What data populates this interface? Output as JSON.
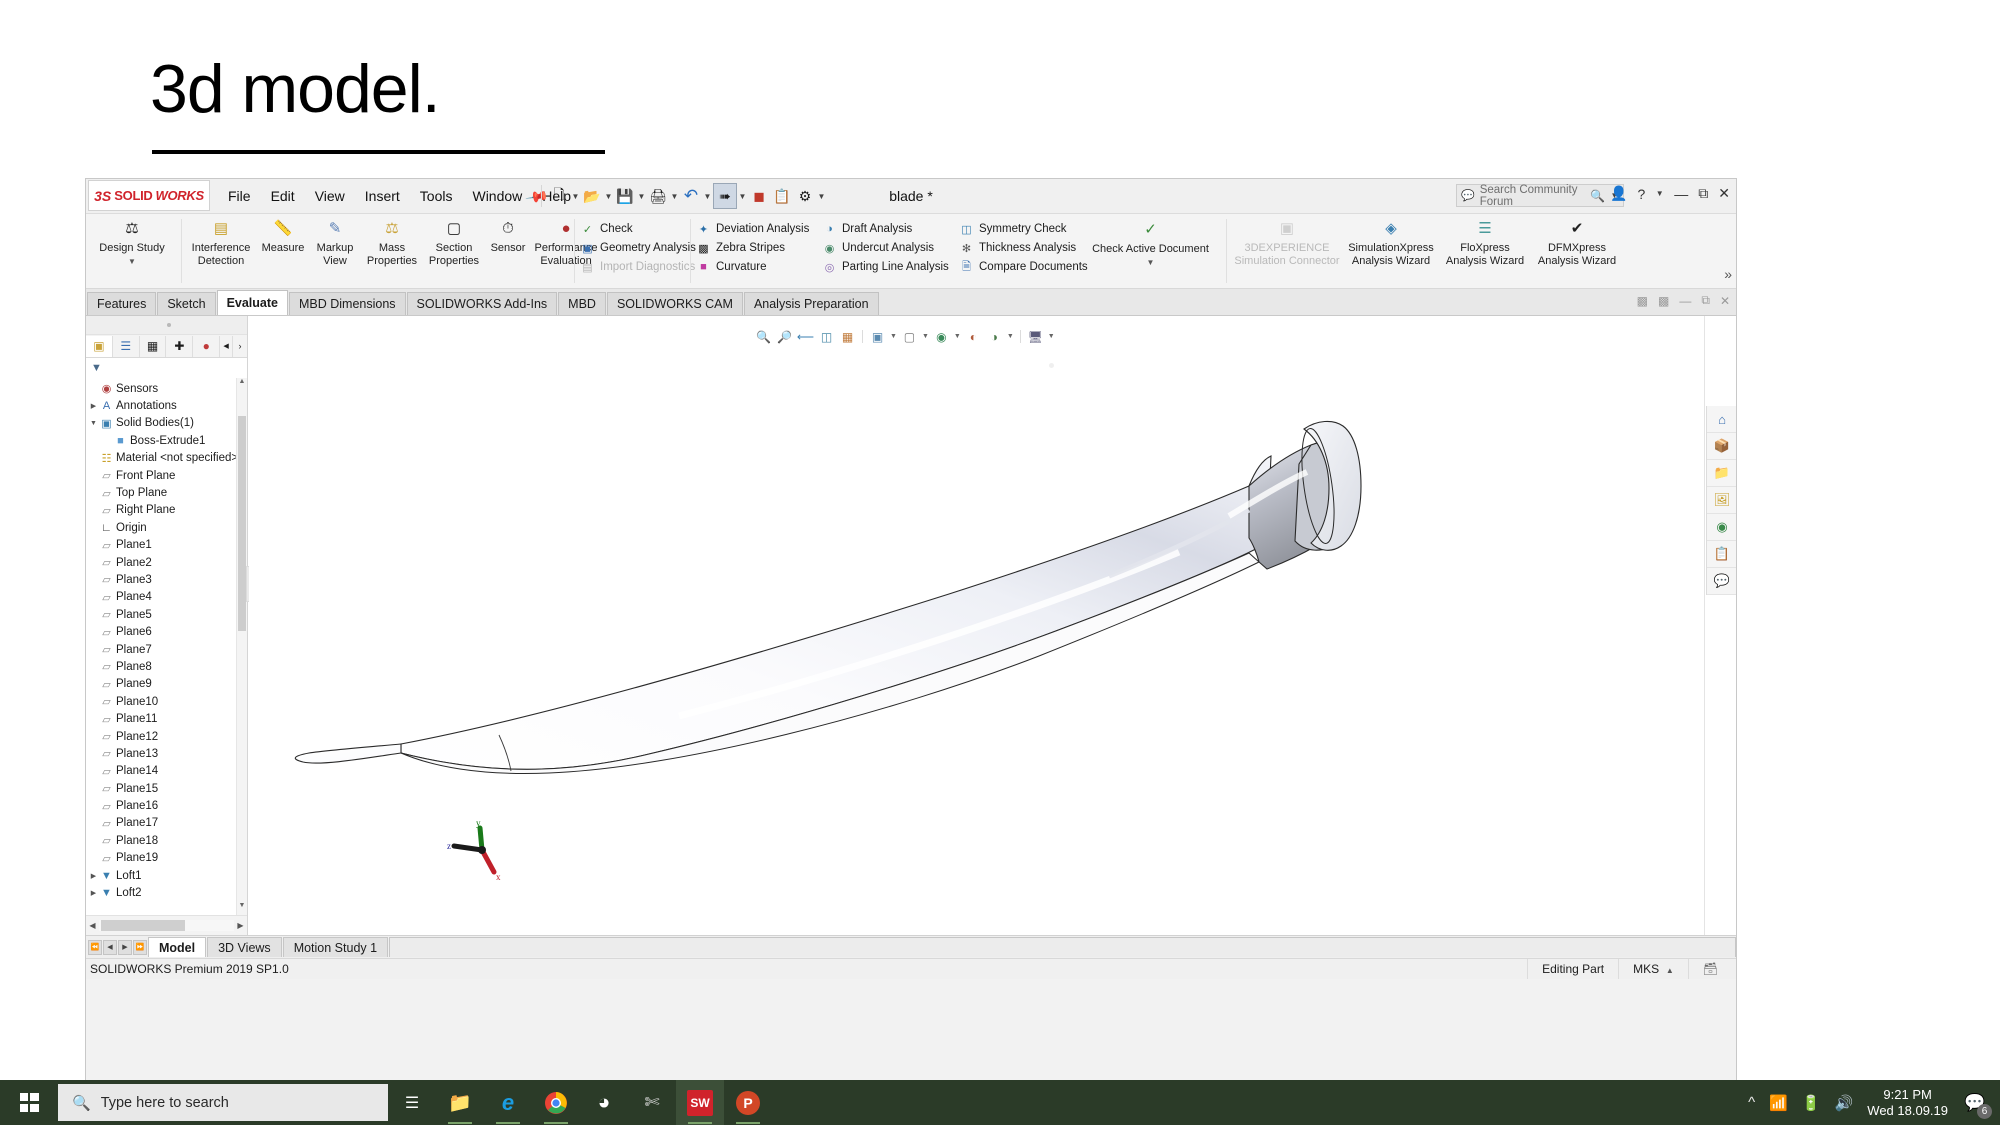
{
  "slide": {
    "title": "3d model."
  },
  "app": {
    "logo": {
      "ds": "3S",
      "solid": "SOLID",
      "works": "WORKS"
    },
    "menu": [
      "File",
      "Edit",
      "View",
      "Insert",
      "Tools",
      "Window",
      "Help"
    ],
    "pin_icon": "pushpin-icon",
    "quick_tools": [
      {
        "name": "new-document",
        "glyph": "🗋",
        "caret": true
      },
      {
        "name": "open-document",
        "glyph": "📂",
        "caret": true
      },
      {
        "name": "save-document",
        "glyph": "💾",
        "caret": true
      },
      {
        "name": "print-document",
        "glyph": "🖨",
        "caret": true
      },
      {
        "name": "undo",
        "glyph": "↶",
        "caret": true
      },
      {
        "name": "select",
        "glyph": "➤",
        "caret": true
      },
      {
        "name": "rebuild",
        "glyph": "🚦",
        "caret": false
      },
      {
        "name": "file-properties",
        "glyph": "📋",
        "caret": false
      },
      {
        "name": "options",
        "glyph": "⚙",
        "caret": true
      }
    ],
    "document_title": "blade *",
    "search": {
      "placeholder": "Search Community Forum",
      "icon": "comment-search-icon"
    },
    "window_controls": [
      "user-icon",
      "help-icon",
      "help-caret",
      "minimize",
      "restore",
      "close"
    ],
    "ribbon": {
      "design_study": {
        "label_line1": "Design Study",
        "label_line2": "",
        "icon": "design-study-icon"
      },
      "big_buttons": [
        {
          "line1": "Interference",
          "line2": "Detection",
          "icon": "interference-detection-icon"
        },
        {
          "line1": "Measure",
          "line2": "",
          "icon": "measure-icon"
        },
        {
          "line1": "Markup",
          "line2": "View",
          "icon": "markup-view-icon"
        },
        {
          "line1": "Mass",
          "line2": "Properties",
          "icon": "mass-properties-icon"
        },
        {
          "line1": "Section",
          "line2": "Properties",
          "icon": "section-properties-icon"
        },
        {
          "line1": "Sensor",
          "line2": "",
          "icon": "sensor-icon"
        },
        {
          "line1": "Performance",
          "line2": "Evaluation",
          "icon": "performance-evaluation-icon"
        }
      ],
      "column_a": [
        {
          "label": "Check",
          "icon": "check-icon",
          "disabled": false
        },
        {
          "label": "Geometry Analysis",
          "icon": "geometry-analysis-icon",
          "disabled": false
        },
        {
          "label": "Import Diagnostics",
          "icon": "import-diagnostics-icon",
          "disabled": true
        }
      ],
      "column_b": [
        {
          "label": "Deviation Analysis",
          "icon": "deviation-analysis-icon",
          "disabled": false
        },
        {
          "label": "Zebra Stripes",
          "icon": "zebra-stripes-icon",
          "disabled": false
        },
        {
          "label": "Curvature",
          "icon": "curvature-icon",
          "disabled": false
        }
      ],
      "column_c": [
        {
          "label": "Draft Analysis",
          "icon": "draft-analysis-icon",
          "disabled": false
        },
        {
          "label": "Undercut Analysis",
          "icon": "undercut-analysis-icon",
          "disabled": false
        },
        {
          "label": "Parting Line Analysis",
          "icon": "parting-line-analysis-icon",
          "disabled": false
        }
      ],
      "column_d": [
        {
          "label": "Symmetry Check",
          "icon": "symmetry-check-icon",
          "disabled": false
        },
        {
          "label": "Thickness Analysis",
          "icon": "thickness-analysis-icon",
          "disabled": false
        },
        {
          "label": "Compare Documents",
          "icon": "compare-documents-icon",
          "disabled": false
        }
      ],
      "check_active": {
        "line1": "Check Active Document",
        "icon": "check-active-document-icon"
      },
      "wizards": [
        {
          "line1": "3DEXPERIENCE",
          "line2": "Simulation Connector",
          "icon": "3dexperience-connector-icon",
          "disabled": true
        },
        {
          "line1": "SimulationXpress",
          "line2": "Analysis Wizard",
          "icon": "simulationxpress-icon",
          "disabled": false
        },
        {
          "line1": "FloXpress",
          "line2": "Analysis Wizard",
          "icon": "floxpress-icon",
          "disabled": false
        },
        {
          "line1": "DFMXpress",
          "line2": "Analysis Wizard",
          "icon": "dfmxpress-icon",
          "disabled": false
        }
      ],
      "overflow": "»"
    },
    "command_tabs": [
      {
        "label": "Features",
        "active": false
      },
      {
        "label": "Sketch",
        "active": false
      },
      {
        "label": "Evaluate",
        "active": true
      },
      {
        "label": "MBD Dimensions",
        "active": false
      },
      {
        "label": "SOLIDWORKS Add-Ins",
        "active": false
      },
      {
        "label": "MBD",
        "active": false
      },
      {
        "label": "SOLIDWORKS CAM",
        "active": false
      },
      {
        "label": "Analysis Preparation",
        "active": false
      }
    ],
    "doc_window_controls": [
      "tile-left",
      "tile-right",
      "minimize",
      "restore",
      "close"
    ],
    "feature_manager": {
      "tabs": [
        {
          "name": "feature-tree-tab",
          "icon": "feature-tree-icon",
          "active": true
        },
        {
          "name": "property-manager-tab",
          "icon": "property-manager-icon",
          "active": false
        },
        {
          "name": "configuration-manager-tab",
          "icon": "configuration-manager-icon",
          "active": false
        },
        {
          "name": "dimxpert-manager-tab",
          "icon": "dimxpert-icon",
          "active": false
        },
        {
          "name": "display-manager-tab",
          "icon": "display-manager-icon",
          "active": false
        }
      ],
      "filter_icon": "filter-icon",
      "tree": [
        {
          "label": "Sensors",
          "icon": "sensors-icon",
          "indent": 1,
          "twisty": "none"
        },
        {
          "label": "Annotations",
          "icon": "annotations-icon",
          "indent": 1,
          "twisty": "right"
        },
        {
          "label": "Solid Bodies(1)",
          "icon": "solid-bodies-icon",
          "indent": 1,
          "twisty": "down"
        },
        {
          "label": "Boss-Extrude1",
          "icon": "boss-extrude-icon",
          "indent": 2,
          "twisty": "none"
        },
        {
          "label": "Material <not specified>",
          "icon": "material-icon",
          "indent": 1,
          "twisty": "none"
        },
        {
          "label": "Front Plane",
          "icon": "plane-icon",
          "indent": 1,
          "twisty": "none"
        },
        {
          "label": "Top Plane",
          "icon": "plane-icon",
          "indent": 1,
          "twisty": "none"
        },
        {
          "label": "Right Plane",
          "icon": "plane-icon",
          "indent": 1,
          "twisty": "none"
        },
        {
          "label": "Origin",
          "icon": "origin-icon",
          "indent": 1,
          "twisty": "none"
        },
        {
          "label": "Plane1",
          "icon": "plane-icon",
          "indent": 1,
          "twisty": "none"
        },
        {
          "label": "Plane2",
          "icon": "plane-icon",
          "indent": 1,
          "twisty": "none"
        },
        {
          "label": "Plane3",
          "icon": "plane-icon",
          "indent": 1,
          "twisty": "none"
        },
        {
          "label": "Plane4",
          "icon": "plane-icon",
          "indent": 1,
          "twisty": "none"
        },
        {
          "label": "Plane5",
          "icon": "plane-icon",
          "indent": 1,
          "twisty": "none"
        },
        {
          "label": "Plane6",
          "icon": "plane-icon",
          "indent": 1,
          "twisty": "none"
        },
        {
          "label": "Plane7",
          "icon": "plane-icon",
          "indent": 1,
          "twisty": "none"
        },
        {
          "label": "Plane8",
          "icon": "plane-icon",
          "indent": 1,
          "twisty": "none"
        },
        {
          "label": "Plane9",
          "icon": "plane-icon",
          "indent": 1,
          "twisty": "none"
        },
        {
          "label": "Plane10",
          "icon": "plane-icon",
          "indent": 1,
          "twisty": "none"
        },
        {
          "label": "Plane11",
          "icon": "plane-icon",
          "indent": 1,
          "twisty": "none"
        },
        {
          "label": "Plane12",
          "icon": "plane-icon",
          "indent": 1,
          "twisty": "none"
        },
        {
          "label": "Plane13",
          "icon": "plane-icon",
          "indent": 1,
          "twisty": "none"
        },
        {
          "label": "Plane14",
          "icon": "plane-icon",
          "indent": 1,
          "twisty": "none"
        },
        {
          "label": "Plane15",
          "icon": "plane-icon",
          "indent": 1,
          "twisty": "none"
        },
        {
          "label": "Plane16",
          "icon": "plane-icon",
          "indent": 1,
          "twisty": "none"
        },
        {
          "label": "Plane17",
          "icon": "plane-icon",
          "indent": 1,
          "twisty": "none"
        },
        {
          "label": "Plane18",
          "icon": "plane-icon",
          "indent": 1,
          "twisty": "none"
        },
        {
          "label": "Plane19",
          "icon": "plane-icon",
          "indent": 1,
          "twisty": "none"
        },
        {
          "label": "Loft1",
          "icon": "loft-icon",
          "indent": 1,
          "twisty": "right"
        },
        {
          "label": "Loft2",
          "icon": "loft-icon",
          "indent": 1,
          "twisty": "right"
        }
      ]
    },
    "heads_up_view": [
      {
        "name": "zoom-to-fit",
        "glyph": "🔍",
        "caret": false
      },
      {
        "name": "zoom-to-area",
        "glyph": "🔎",
        "caret": false
      },
      {
        "name": "previous-view",
        "glyph": "↖",
        "caret": false
      },
      {
        "name": "section-view",
        "glyph": "◧",
        "caret": false
      },
      {
        "name": "view-orientation",
        "glyph": "◱",
        "caret": false
      },
      {
        "name": "display-style",
        "glyph": "▣",
        "caret": true
      },
      {
        "name": "hide-show-items",
        "glyph": "□",
        "caret": true
      },
      {
        "name": "edit-appearance",
        "glyph": "◐",
        "caret": true
      },
      {
        "name": "apply-scene",
        "glyph": "◑",
        "caret": false
      },
      {
        "name": "view-settings",
        "glyph": "◕",
        "caret": true
      },
      {
        "name": "display-viewport",
        "glyph": "⬜",
        "caret": true
      }
    ],
    "task_pane": [
      {
        "name": "solidworks-resources-icon",
        "glyph": "⌂"
      },
      {
        "name": "design-library-icon",
        "glyph": "📦"
      },
      {
        "name": "file-explorer-icon",
        "glyph": "📁"
      },
      {
        "name": "view-palette-icon",
        "glyph": "🖼"
      },
      {
        "name": "appearances-scenes-icon",
        "glyph": "◕"
      },
      {
        "name": "custom-properties-icon",
        "glyph": "📋"
      },
      {
        "name": "markup-icon",
        "glyph": "💬"
      }
    ],
    "triad": {
      "x": "x",
      "y": "y",
      "z": "z"
    },
    "bottom_tabs": [
      {
        "label": "Model",
        "active": true
      },
      {
        "label": "3D Views",
        "active": false
      },
      {
        "label": "Motion Study 1",
        "active": false
      }
    ],
    "status": {
      "left": "SOLIDWORKS Premium 2019 SP1.0",
      "editing": "Editing Part",
      "units": "MKS",
      "units_caret": "▲",
      "overlay_icon": "layers-icon"
    }
  },
  "taskbar": {
    "start_icon": "windows-logo-icon",
    "search_placeholder": "Type here to search",
    "task_view_icon": "task-view-icon",
    "apps": [
      {
        "name": "file-explorer-icon",
        "glyph": "📁",
        "color": "#ffc84a",
        "running": true,
        "active": false
      },
      {
        "name": "internet-explorer-icon",
        "glyph": "e",
        "color": "#1b9de2",
        "running": true,
        "active": false
      },
      {
        "name": "google-chrome-icon",
        "glyph": "●",
        "color": "#4285f4",
        "running": true,
        "active": false
      },
      {
        "name": "cortana-icon",
        "glyph": "○",
        "color": "#ffffff",
        "running": false,
        "active": false
      },
      {
        "name": "snipping-tool-icon",
        "glyph": "✂",
        "color": "#d8d8d8",
        "running": false,
        "active": false
      },
      {
        "name": "solidworks-icon",
        "glyph": "SW",
        "color": "#d0232b",
        "running": true,
        "active": true
      },
      {
        "name": "powerpoint-icon",
        "glyph": "P",
        "color": "#d24726",
        "running": true,
        "active": false
      }
    ],
    "tray": {
      "chevron_icon": "show-hidden-icons-icon",
      "network_icon": "wifi-icon",
      "battery_icon": "battery-warning-icon",
      "volume_icon": "volume-icon",
      "time": "9:21 PM",
      "date": "Wed 18.09.19",
      "notifications_icon": "action-center-icon",
      "notifications_count": "6"
    }
  },
  "colors": {
    "brand_red": "#d0232b",
    "taskbar": "#2b3b28",
    "accent_blue": "#1a6fb5"
  }
}
